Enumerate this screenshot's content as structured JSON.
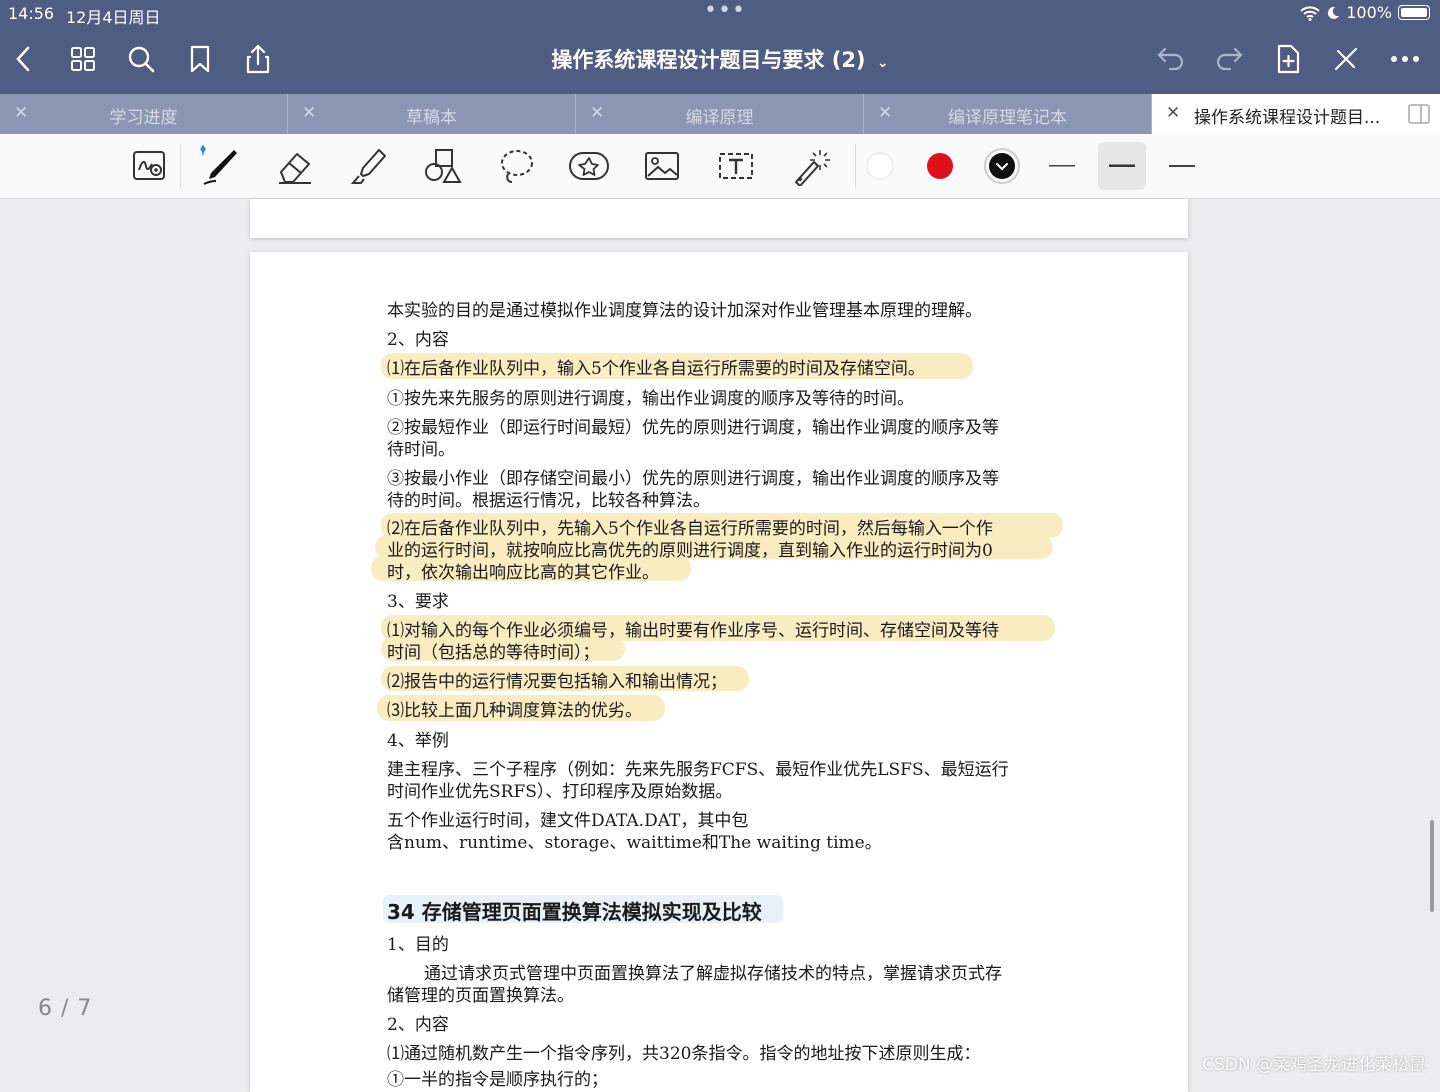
{
  "status": {
    "time": "14:56",
    "date": "12月4日周日",
    "battery": "100%"
  },
  "document": {
    "title": "操作系统课程设计题目与要求 (2)"
  },
  "tabs": [
    "学习进度",
    "草稿本",
    "编译原理",
    "编译原理笔记本",
    "操作系统课程设计题目..."
  ],
  "pen_colors": [
    "#ffffff",
    "#e0101a",
    "#111111"
  ],
  "page_indicator": "6 / 7",
  "watermark": "CSDN @菜鸡圣龙进化菜松鼠",
  "content": {
    "l1": "本实验的目的是通过模拟作业调度算法的设计加深对作业管理基本原理的理解。",
    "l2": "2、内容",
    "l3": "⑴在后备作业队列中，输入5个作业各自运行所需要的时间及存储空间。",
    "l4": "①按先来先服务的原则进行调度，输出作业调度的顺序及等待的时间。",
    "l5": "②按最短作业（即运行时间最短）优先的原则进行调度，输出作业调度的顺序及等",
    "l6": "待时间。",
    "l7": "③按最小作业（即存储空间最小）优先的原则进行调度，输出作业调度的顺序及等",
    "l8": "待的时间。根据运行情况，比较各种算法。",
    "l9": "⑵在后备作业队列中，先输入5个作业各自运行所需要的时间，然后每输入一个作",
    "l10": "业的运行时间，就按响应比高优先的原则进行调度，直到输入作业的运行时间为0",
    "l11": "时，依次输出响应比高的其它作业。",
    "l12": "3、要求",
    "l13": "⑴对输入的每个作业必须编号，输出时要有作业序号、运行时间、存储空间及等待",
    "l14": "时间（包括总的等待时间）；",
    "l15": "⑵报告中的运行情况要包括输入和输出情况；",
    "l16": "⑶比较上面几种调度算法的优劣。",
    "l17": "4、举例",
    "l18": "建主程序、三个子程序（例如：先来先服务FCFS、最短作业优先LSFS、最短运行",
    "l19": "时间作业优先SRFS）、打印程序及原始数据。",
    "l20": "五个作业运行时间，建文件DATA.DAT，其中包",
    "l21": "含num、runtime、storage、waittime和The waiting time。",
    "h2": "34 存储管理页面置换算法模拟实现及比较",
    "l22": "1、目的",
    "l23": "通过请求页式管理中页面置换算法了解虚拟存储技术的特点，掌握请求页式存",
    "l24": "储管理的页面置换算法。",
    "l25": "2、内容",
    "l26": "⑴通过随机数产生一个指令序列，共320条指令。指令的地址按下述原则生成：",
    "l27": "①一半的指令是顺序执行的；"
  }
}
